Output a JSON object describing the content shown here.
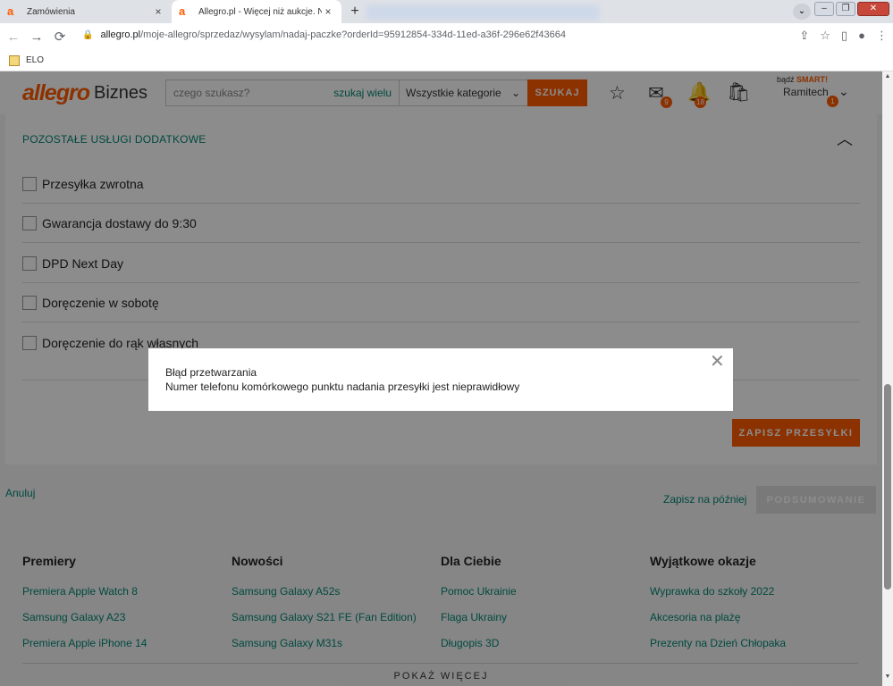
{
  "browser": {
    "tabs": [
      {
        "title": "Zamówienia",
        "close": "×",
        "favicon": "a"
      },
      {
        "title": "Allegro.pl - Więcej niż aukcje. Na",
        "close": "×",
        "favicon": "a"
      }
    ],
    "new_tab": "+",
    "url_host": "allegro.pl",
    "url_path": "/moje-allegro/sprzedaz/wysylam/nadaj-paczke?orderId=95912854-334d-11ed-a36f-296e62f43664",
    "bookmark": "ELO"
  },
  "header": {
    "logo": "allegro",
    "logo_suffix": "Biznes",
    "search_placeholder": "czego szukasz?",
    "search_many": "szukaj wielu",
    "category": "Wszystkie kategorie",
    "search_button": "SZUKAJ",
    "messages_badge": "9",
    "notifications_badge": "18",
    "smart_prefix": "bądź",
    "smart_label": "SMART!",
    "user_name": "Ramitech",
    "user_badge": "1"
  },
  "section": {
    "title": "POZOSTAŁE USŁUGI DODATKOWE",
    "options": [
      {
        "label": "Przesyłka zwrotna"
      },
      {
        "label": "Gwarancja dostawy do 9:30"
      },
      {
        "label": "DPD Next Day"
      },
      {
        "label": "Doręczenie w sobotę"
      },
      {
        "label": "Doręczenie do rąk własnych"
      }
    ],
    "save_button": "ZAPISZ PRZESYŁKI"
  },
  "actions": {
    "cancel": "Anuluj",
    "save_later": "Zapisz na później",
    "summary": "PODSUMOWANIE"
  },
  "footer": {
    "columns": [
      {
        "title": "Premiery",
        "links": [
          "Premiera Apple Watch 8",
          "Samsung Galaxy A23",
          "Premiera Apple iPhone 14"
        ]
      },
      {
        "title": "Nowości",
        "links": [
          "Samsung Galaxy A52s",
          "Samsung Galaxy S21 FE (Fan Edition)",
          "Samsung Galaxy M31s"
        ]
      },
      {
        "title": "Dla Ciebie",
        "links": [
          "Pomoc Ukrainie",
          "Flaga Ukrainy",
          "Długopis 3D"
        ]
      },
      {
        "title": "Wyjątkowe okazje",
        "links": [
          "Wyprawka do szkoły 2022",
          "Akcesoria na plażę",
          "Prezenty na Dzień Chłopaka"
        ]
      }
    ],
    "show_more": "POKAŻ WIĘCEJ"
  },
  "modal": {
    "title": "Błąd przetwarzania",
    "message": "Numer telefonu komórkowego punktu nadania przesyłki jest nieprawidłowy"
  },
  "colors": {
    "accent": "#ff5a00",
    "link": "#008673"
  }
}
